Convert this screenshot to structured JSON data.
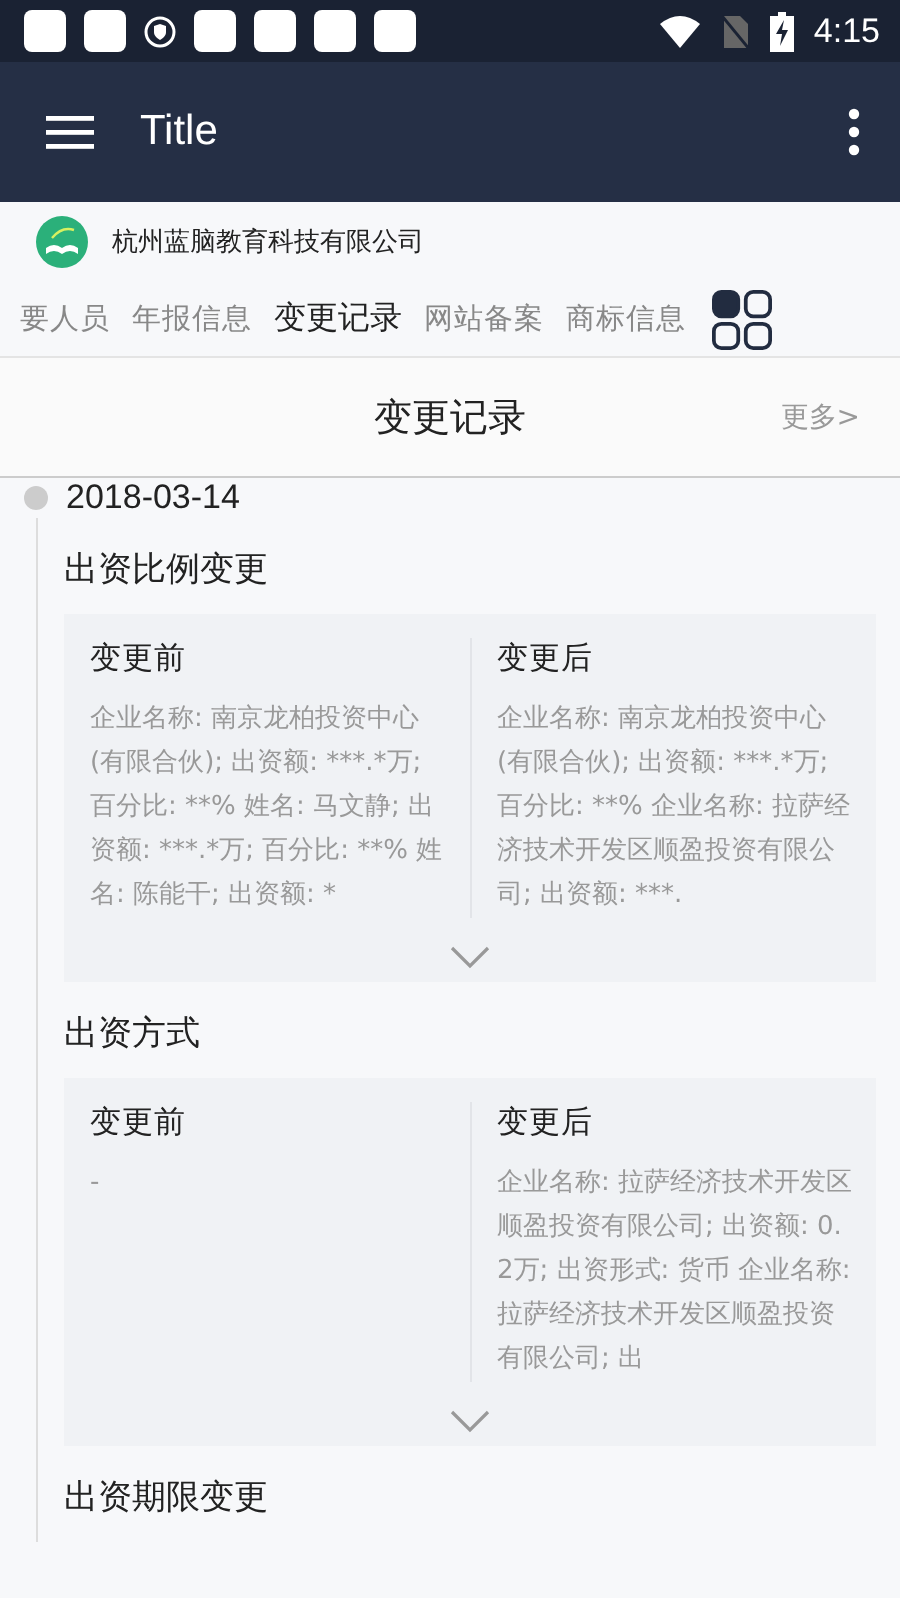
{
  "status_bar": {
    "time": "4:15"
  },
  "app_bar": {
    "title": "Title"
  },
  "company": {
    "name": "杭州蓝脑教育科技有限公司"
  },
  "tabs": [
    {
      "label": "要人员",
      "selected": false
    },
    {
      "label": "年报信息",
      "selected": false
    },
    {
      "label": "变更记录",
      "selected": true
    },
    {
      "label": "网站备案",
      "selected": false
    },
    {
      "label": "商标信息",
      "selected": false
    }
  ],
  "section": {
    "title": "变更记录",
    "more": "更多>"
  },
  "records": [
    {
      "date": "2018-03-14",
      "changes": [
        {
          "title": "出资比例变更",
          "before_label": "变更前",
          "before": "企业名称: 南京龙柏投资中心(有限合伙); 出资额: ***.*万; 百分比: **% 姓名: 马文静; 出资额: ***.*万; 百分比: **% 姓名: 陈能干; 出资额: *",
          "after_label": "变更后",
          "after": "企业名称: 南京龙柏投资中心(有限合伙); 出资额: ***.*万; 百分比: **% 企业名称: 拉萨经济技术开发区顺盈投资有限公司; 出资额: ***.",
          "expandable": true
        },
        {
          "title": "出资方式",
          "before_label": "变更前",
          "before": "-",
          "after_label": "变更后",
          "after": "企业名称: 拉萨经济技术开发区顺盈投资有限公司; 出资额: 0.2万; 出资形式: 货币 企业名称: 拉萨经济技术开发区顺盈投资有限公司; 出",
          "expandable": true
        },
        {
          "title": "出资期限变更"
        }
      ]
    }
  ]
}
